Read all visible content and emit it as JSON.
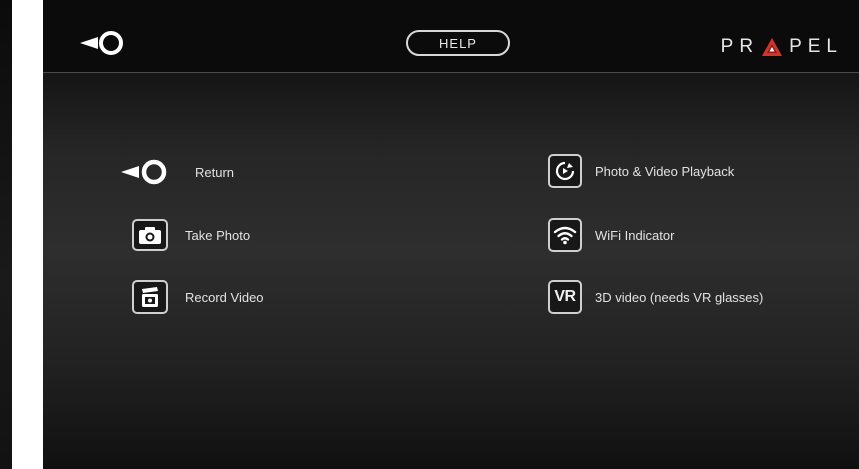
{
  "topbar": {
    "help_label": "HELP",
    "brand_name_left": "PR",
    "brand_name_right": "PEL",
    "brand_logo_alt": "A",
    "brand_accent": "#d0342c"
  },
  "legend": {
    "left": [
      {
        "label": "Return",
        "icon": "back-icon"
      },
      {
        "label": "Take Photo",
        "icon": "camera-icon"
      },
      {
        "label": "Record Video",
        "icon": "video-record-icon"
      }
    ],
    "right": [
      {
        "label": "Photo & Video Playback",
        "icon": "playback-icon"
      },
      {
        "label": "WiFi Indicator",
        "icon": "wifi-icon"
      },
      {
        "label": "3D video (needs VR glasses)",
        "icon": "vr-icon",
        "icon_text": "VR"
      }
    ]
  }
}
